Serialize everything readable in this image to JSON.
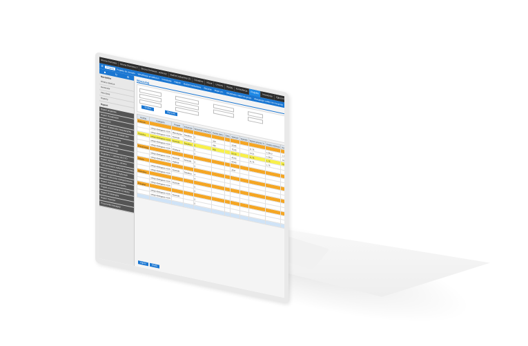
{
  "top_tabs": [
    {
      "label": "Strona Domowa",
      "active": false
    },
    {
      "label": "Strona Domowa 2",
      "active": false
    },
    {
      "label": "Strona Domowa - wykresy",
      "active": false
    },
    {
      "label": "Budżet zakupowy (2)",
      "active": false
    },
    {
      "label": "Działalne",
      "active": false
    },
    {
      "label": "Klient",
      "active": false
    },
    {
      "label": "Umowy",
      "active": false
    },
    {
      "label": "Wydaj",
      "active": false
    },
    {
      "label": "Konsultacja",
      "active": false
    },
    {
      "label": "Projekty",
      "active": true
    },
    {
      "label": "Inwestycje",
      "active": false
    },
    {
      "label": "Zgłoszenia",
      "active": false
    }
  ],
  "menu": [
    {
      "label": "Projekty",
      "active": true
    },
    {
      "label": "Projekty do zarządu",
      "active": false
    },
    {
      "label": "Weryfikacja przedłożeń",
      "active": false
    },
    {
      "label": "Inwestycje",
      "active": false
    },
    {
      "label": "Rejestr",
      "active": false
    },
    {
      "label": "Budżet kaskadowe",
      "active": false
    },
    {
      "label": "Zlecenie",
      "active": false
    },
    {
      "label": "Mapa urz.",
      "active": false
    },
    {
      "label": "Akceptacja zadań do grupy",
      "active": false
    },
    {
      "label": "Akceptacja zadań nie ma grupy",
      "active": false
    }
  ],
  "sidebar": {
    "section1": "Narzędzia",
    "items1": [
      "Strona robocza",
      "Generator",
      "Inne dane",
      "Raporty"
    ],
    "section2": "Raport",
    "items2": [
      "Raport projektów",
      "Raport Działalności",
      "Raport inw.",
      "Raport działalności inwestycyjnej",
      "Raport wykonania działalności",
      "Struktura podmiotowa",
      "Raport pod komisję",
      "Struktura realizacji",
      "Regularny z zakresu do CTO",
      "Raport wykonania z zakresu",
      "Podsumowanie wykonania rozkładu",
      "Raport inwestycji z wydanych",
      "Raport rozliczenia zaangażowania",
      "Raport zestawienia projektu",
      "Projekt przyznawanie co skrótu",
      "Raport innowacyjny",
      "Raport Kosztów",
      "Przyznanie inwestycji"
    ]
  },
  "page_title": "Wyszukaj",
  "buttons": {
    "search": "Szukaj",
    "clear": "Wyczyść",
    "bottom1": "Zapisz",
    "bottom2": "Wyślij"
  },
  "table_headers": [
    "Rodzaj",
    "Kategoria",
    "Projekt",
    "Instytucja",
    "Wskaźnik realizacji",
    "Kwota planu",
    "Data",
    "Wartość",
    "Wydatki",
    "Wykorzystanie %",
    "Kwota realizacji",
    "Kwota pozostała",
    "Plan",
    "Realizacja",
    "Razem"
  ],
  "rows": [
    {
      "style": "orange",
      "cells": [
        "Budynek",
        "",
        "",
        "",
        "",
        "",
        "",
        "",
        "",
        "",
        "",
        "",
        "",
        "",
        ""
      ]
    },
    {
      "style": "white",
      "cells": [
        "",
        "usługi obsługowe 2015",
        "Mieszkanie",
        "Świetlica",
        "5",
        "300",
        "",
        "26,85",
        "",
        "11 75",
        "1,5/0,0",
        "1,75",
        "0,00",
        "",
        ""
      ]
    },
    {
      "style": "white",
      "cells": [
        "",
        "usługi obsługowe 2015",
        "Kontrakt",
        "Świetlica",
        "5",
        "460",
        "",
        "75,43",
        "",
        "14 51",
        "1,5/0,0",
        "14,75",
        "0,00",
        "",
        ""
      ]
    },
    {
      "style": "yellow",
      "cells": [
        "Świetlica",
        "usługi obsługowe 2015",
        "Kontrakt",
        "Świetlica",
        "5",
        "400",
        "",
        "53,28",
        "",
        "11,75",
        "1,75",
        "10,75",
        "0,00",
        "",
        ""
      ]
    },
    {
      "style": "white",
      "cells": [
        "",
        "usługi obsługowe 2015",
        "",
        "",
        "5",
        "",
        "",
        "45,53",
        "",
        "11,75",
        "1,75",
        "",
        "",
        "",
        ""
      ]
    },
    {
      "style": "white",
      "cells": [
        "",
        "usługi obsługowe 2015",
        "Działanie",
        "",
        "5",
        "",
        "",
        "84,83",
        "",
        "",
        "",
        "",
        "",
        "",
        ""
      ]
    },
    {
      "style": "orange",
      "cells": [
        "Przedszkole",
        "",
        "",
        "",
        "",
        "",
        "",
        "",
        "",
        "",
        "",
        "",
        "",
        "",
        ""
      ]
    },
    {
      "style": "white",
      "cells": [
        "",
        "usługi obsługowe 2015",
        "Kontrakt",
        "Kontrakt",
        "5",
        "",
        "",
        "49,8",
        "",
        "",
        "",
        "",
        "",
        "",
        ""
      ]
    },
    {
      "style": "white",
      "cells": [
        "",
        "usługi obsługowe 2015",
        "Oddział",
        "",
        "5",
        "",
        "",
        "",
        "",
        "",
        "",
        "",
        "",
        "",
        ""
      ]
    },
    {
      "style": "orange",
      "cells": [
        "Szkoła",
        "",
        "",
        "",
        "",
        "",
        "",
        "",
        "",
        "",
        "",
        "",
        "",
        "",
        ""
      ]
    },
    {
      "style": "white",
      "cells": [
        "",
        "usługi obsługowe 2015",
        "Kontrakt",
        "Świetlica",
        "4",
        "",
        "",
        "",
        "",
        "",
        "",
        "",
        "",
        "",
        ""
      ]
    },
    {
      "style": "white",
      "cells": [
        "",
        "usługi obsługowe 2015",
        "",
        "",
        "4",
        "",
        "",
        "",
        "",
        "",
        "",
        "",
        "",
        "",
        ""
      ]
    },
    {
      "style": "orange",
      "cells": [
        "Biblioteka",
        "",
        "",
        "",
        "",
        "",
        "",
        "",
        "",
        "",
        "",
        "",
        "",
        "",
        ""
      ]
    },
    {
      "style": "white",
      "cells": [
        "",
        "usługi obsługowe 2015",
        "Kontrakt",
        "",
        "5",
        "",
        "",
        "",
        "",
        "",
        "",
        "",
        "",
        "",
        ""
      ]
    },
    {
      "style": "white",
      "cells": [
        "",
        "usługi obsługowe 2015",
        "",
        "",
        "5",
        "",
        "",
        "",
        "",
        "",
        "",
        "",
        "",
        "",
        ""
      ]
    },
    {
      "style": "orange",
      "cells": [
        "Przegląd",
        "",
        "",
        "",
        "",
        "",
        "",
        "",
        "",
        "",
        "",
        "",
        "",
        "",
        ""
      ]
    },
    {
      "style": "white",
      "cells": [
        "",
        "usługi obsługowe 2015",
        "Kontrakt",
        "",
        "5",
        "",
        "",
        "",
        "",
        "",
        "",
        "",
        "",
        "",
        ""
      ]
    },
    {
      "style": "white",
      "cells": [
        "",
        "usługi obsługowe 2015",
        "",
        "",
        "5",
        "",
        "",
        "",
        "",
        "",
        "",
        "",
        "",
        "",
        ""
      ]
    },
    {
      "style": "blue",
      "cells": [
        "",
        "",
        "",
        "",
        "",
        "",
        "",
        "",
        "",
        "",
        "",
        "",
        "",
        "",
        ""
      ]
    }
  ]
}
